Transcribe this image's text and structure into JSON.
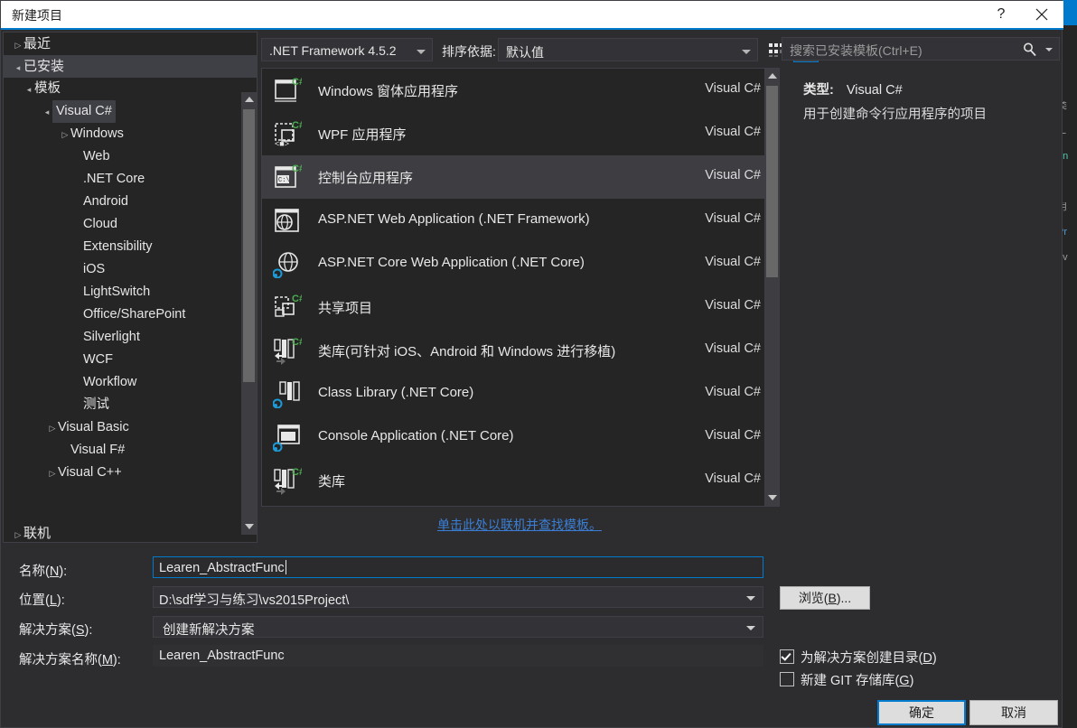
{
  "window": {
    "title": "新建项目",
    "help_label": "?",
    "close_label": "close-icon"
  },
  "sidebar": {
    "items": [
      {
        "label": "最近",
        "arrow": "collapsed",
        "indent": 10,
        "selected": false
      },
      {
        "label": "已安装",
        "arrow": "expanded",
        "indent": 10,
        "selected": true
      },
      {
        "label": "模板",
        "arrow": "expanded",
        "indent": 22,
        "selected": false
      },
      {
        "label": "Visual C#",
        "arrow": "expanded",
        "indent": 42,
        "selected": false,
        "highlight": true
      },
      {
        "label": "Windows",
        "arrow": "collapsed",
        "indent": 62,
        "selected": false
      },
      {
        "label": "Web",
        "arrow": "none",
        "indent": 76,
        "selected": false
      },
      {
        "label": ".NET Core",
        "arrow": "none",
        "indent": 76,
        "selected": false
      },
      {
        "label": "Android",
        "arrow": "none",
        "indent": 76,
        "selected": false
      },
      {
        "label": "Cloud",
        "arrow": "none",
        "indent": 76,
        "selected": false
      },
      {
        "label": "Extensibility",
        "arrow": "none",
        "indent": 76,
        "selected": false
      },
      {
        "label": "iOS",
        "arrow": "none",
        "indent": 76,
        "selected": false
      },
      {
        "label": "LightSwitch",
        "arrow": "none",
        "indent": 76,
        "selected": false
      },
      {
        "label": "Office/SharePoint",
        "arrow": "none",
        "indent": 76,
        "selected": false
      },
      {
        "label": "Silverlight",
        "arrow": "none",
        "indent": 76,
        "selected": false
      },
      {
        "label": "WCF",
        "arrow": "none",
        "indent": 76,
        "selected": false
      },
      {
        "label": "Workflow",
        "arrow": "none",
        "indent": 76,
        "selected": false
      },
      {
        "label": "测试",
        "arrow": "none",
        "indent": 76,
        "selected": false
      },
      {
        "label": "Visual Basic",
        "arrow": "collapsed",
        "indent": 48,
        "selected": false
      },
      {
        "label": "Visual F#",
        "arrow": "none",
        "indent": 62,
        "selected": false
      },
      {
        "label": "Visual C++",
        "arrow": "collapsed",
        "indent": 48,
        "selected": false
      }
    ],
    "online_item": {
      "label": "联机",
      "arrow": "collapsed",
      "indent": 10
    }
  },
  "toolbar": {
    "framework": ".NET Framework 4.5.2",
    "sort_label": "排序依据:",
    "sort_value": "默认值",
    "view_small_icon": "small-icons-view-icon",
    "view_large_icon": "list-view-icon"
  },
  "templates": [
    {
      "name": "Windows 窗体应用程序",
      "lang": "Visual C#",
      "icon": "winforms-csharp-icon",
      "selected": false
    },
    {
      "name": "WPF 应用程序",
      "lang": "Visual C#",
      "icon": "wpf-csharp-icon",
      "selected": false
    },
    {
      "name": "控制台应用程序",
      "lang": "Visual C#",
      "icon": "console-csharp-icon",
      "selected": true
    },
    {
      "name": "ASP.NET Web Application (.NET Framework)",
      "lang": "Visual C#",
      "icon": "aspnet-web-icon",
      "selected": false
    },
    {
      "name": "ASP.NET Core Web Application (.NET Core)",
      "lang": "Visual C#",
      "icon": "aspnet-core-web-icon",
      "selected": false
    },
    {
      "name": "共享项目",
      "lang": "Visual C#",
      "icon": "shared-project-icon",
      "selected": false
    },
    {
      "name": "类库(可针对 iOS、Android 和 Windows 进行移植)",
      "lang": "Visual C#",
      "icon": "portable-class-library-icon",
      "selected": false
    },
    {
      "name": "Class Library (.NET Core)",
      "lang": "Visual C#",
      "icon": "class-library-core-icon",
      "selected": false
    },
    {
      "name": "Console Application (.NET Core)",
      "lang": "Visual C#",
      "icon": "console-core-icon",
      "selected": false
    },
    {
      "name": "类库",
      "lang": "Visual C#",
      "icon": "class-library-csharp-icon",
      "selected": false
    }
  ],
  "online_templates_link": "单击此处以联机并查找模板。",
  "search": {
    "placeholder": "搜索已安装模板(Ctrl+E)",
    "icon": "search-icon"
  },
  "info": {
    "type_label": "类型:",
    "type_value": "Visual C#",
    "description": "用于创建命令行应用程序的项目"
  },
  "form": {
    "name_label_pre": "名称(",
    "name_label_key": "N",
    "name_label_post": "):",
    "name_value": "Learen_AbstractFunc",
    "location_label_pre": "位置(",
    "location_label_key": "L",
    "location_label_post": "):",
    "location_value": "D:\\sdf学习与练习\\vs2015Project\\",
    "solution_label_pre": "解决方案(",
    "solution_label_key": "S",
    "solution_label_post": "):",
    "solution_value": "创建新解决方案",
    "solution_name_label_pre": "解决方案名称(",
    "solution_name_label_key": "M",
    "solution_name_label_post": "):",
    "solution_name_value": "Learen_AbstractFunc",
    "browse_pre": "浏览(",
    "browse_key": "B",
    "browse_post": ")...",
    "create_dir_pre": "为解决方案创建目录(",
    "create_dir_key": "D",
    "create_dir_post": ")",
    "create_dir_checked": true,
    "git_repo_pre": "新建 GIT 存储库(",
    "git_repo_key": "G",
    "git_repo_post": ")",
    "git_repo_checked": false,
    "ok_label": "确定",
    "cancel_label": "取消"
  },
  "colors": {
    "accent": "#007acc",
    "dialog_bg": "#2d2d30",
    "pane_bg": "#252526",
    "selection": "#3e3e42",
    "link": "#3a7fd5",
    "csharp_green": "#4caf50"
  }
}
